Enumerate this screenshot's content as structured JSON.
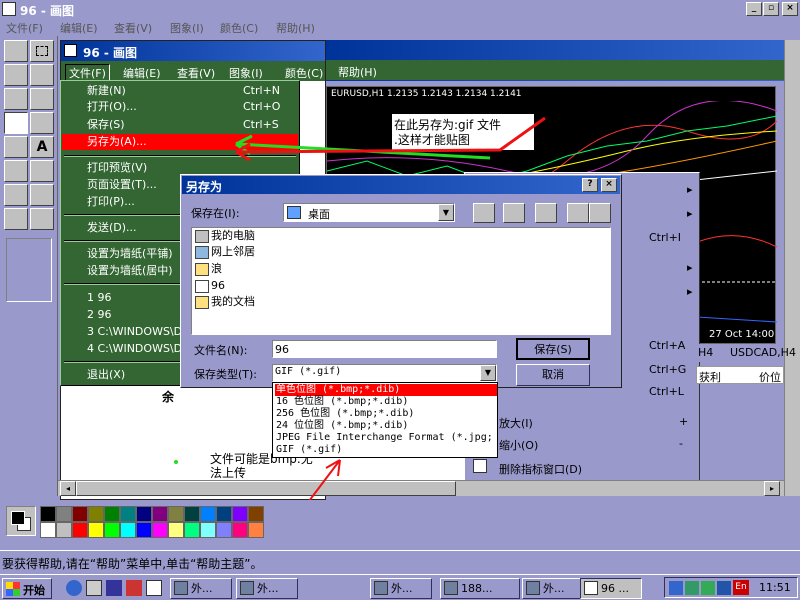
{
  "app": {
    "title": "96 - 画图",
    "menu": [
      "文件(F)",
      "编辑(E)",
      "查看(V)",
      "图象(I)",
      "颜色(C)",
      "帮助(H)"
    ]
  },
  "inner_window": {
    "title": "96 - 画图",
    "menu": [
      "文件(F)",
      "编辑(E)",
      "查看(V)",
      "图象(I)",
      "颜色(C)",
      "帮助(H)"
    ]
  },
  "file_menu": {
    "items": [
      {
        "label": "新建(N)",
        "accel": "Ctrl+N"
      },
      {
        "label": "打开(O)...",
        "accel": "Ctrl+O"
      },
      {
        "label": "保存(S)",
        "accel": "Ctrl+S"
      },
      {
        "label": "另存为(A)...",
        "accel": ""
      },
      {
        "label": "打印预览(V)",
        "accel": ""
      },
      {
        "label": "页面设置(T)...",
        "accel": ""
      },
      {
        "label": "打印(P)...",
        "accel": ""
      },
      {
        "label": "发送(D)...",
        "accel": ""
      },
      {
        "label": "设置为墙纸(平铺)",
        "accel": ""
      },
      {
        "label": "设置为墙纸(居中)",
        "accel": ""
      },
      {
        "label": "1 96",
        "accel": ""
      },
      {
        "label": "2 96",
        "accel": ""
      },
      {
        "label": "3 C:\\WINDOWS\\Des",
        "accel": ""
      },
      {
        "label": "4 C:\\WINDOWS\\Des",
        "accel": ""
      },
      {
        "label": "退出(X)",
        "accel": ""
      }
    ]
  },
  "annotation": {
    "line1": "在此另存为:gif 文件",
    "line2": ".这样才能贴图",
    "bottom1": "文件可能是bmp.无",
    "bottom2": "法上传"
  },
  "chart": {
    "header": "EURUSD,H1  1.2135 1.2143 1.2134 1.2141",
    "date": "27 Oct 14:00",
    "tabs": [
      "H4",
      "USDCAD,H4"
    ],
    "cols": [
      "获利",
      "价位"
    ]
  },
  "side_menu": {
    "accels": [
      "Ctrl+I",
      "Ctrl+A",
      "Ctrl+G",
      "Ctrl+L"
    ],
    "items": [
      {
        "label": "放大(I)",
        "accel": "+"
      },
      {
        "label": "缩小(O)",
        "accel": "-"
      },
      {
        "label": "删除指标窗口(D)",
        "accel": ""
      }
    ]
  },
  "misc": {
    "partial_label": "余"
  },
  "dialog": {
    "title": "另存为",
    "save_in_label": "保存在(I):",
    "save_in_value": "桌面",
    "files": [
      "我的电脑",
      "网上邻居",
      "浪",
      "96",
      "我的文档"
    ],
    "filename_label": "文件名(N):",
    "filename_value": "96",
    "filetype_label": "保存类型(T):",
    "filetype_value": "GIF (*.gif)",
    "save_button": "保存(S)",
    "cancel_button": "取消",
    "type_options": [
      "单色位图 (*.bmp;*.dib)",
      "16 色位图 (*.bmp;*.dib)",
      "256 色位图 (*.bmp;*.dib)",
      "24 位位图 (*.bmp;*.dib)",
      "JPEG File Interchange Format (*.jpg;",
      "GIF (*.gif)"
    ]
  },
  "status": {
    "text": "要获得帮助,请在“帮助”菜单中,单击“帮助主题”。"
  },
  "taskbar": {
    "start": "开始",
    "items": [
      "外...",
      "外...",
      "外...",
      "188...",
      "外...",
      "96 ..."
    ],
    "clock": "11:51",
    "tray_en": "En"
  },
  "palette": [
    "#000000",
    "#808080",
    "#800000",
    "#808000",
    "#008000",
    "#008080",
    "#000080",
    "#800080",
    "#808040",
    "#004040",
    "#0080ff",
    "#004080",
    "#8000ff",
    "#804000",
    "#ffffff",
    "#c0c0c0",
    "#ff0000",
    "#ffff00",
    "#00ff00",
    "#00ffff",
    "#0000ff",
    "#ff00ff",
    "#ffff80",
    "#00ff80",
    "#80ffff",
    "#8080ff",
    "#ff0080",
    "#ff8040"
  ],
  "colors": {
    "title_active": "#003399",
    "menu_highlight": "#ff0000",
    "menu_bg": "#336633",
    "arrow_green": "#22dd22",
    "arrow_red": "#ee1111",
    "chart_bg": "#000000"
  }
}
